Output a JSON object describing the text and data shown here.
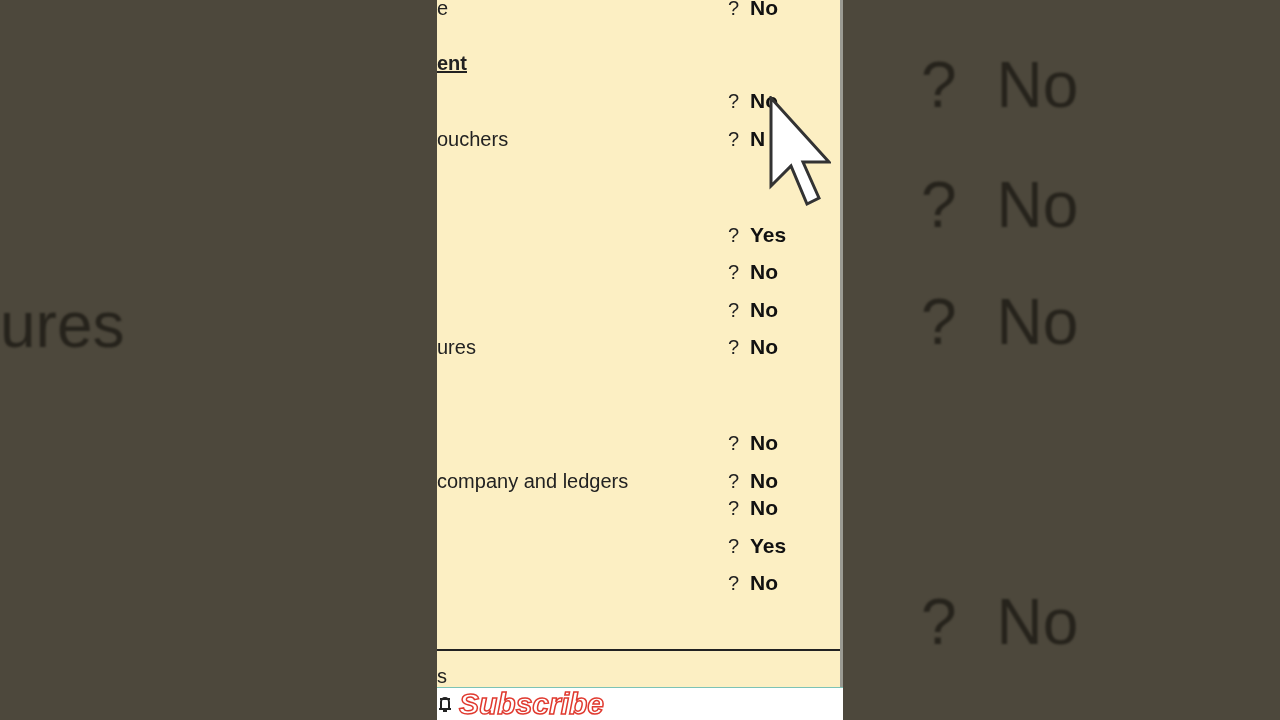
{
  "backdrop": {
    "left": [
      {
        "label": "ures"
      }
    ],
    "right": [
      {
        "mark": "?",
        "value": "No"
      },
      {
        "mark": "?",
        "value": "No"
      },
      {
        "mark": "?",
        "value": "No"
      },
      {
        "mark": "?",
        "value": "No"
      }
    ]
  },
  "panel": {
    "rows": [
      {
        "kind": "option",
        "label": "e",
        "mark": "?",
        "value": "No"
      },
      {
        "kind": "heading",
        "label": "ent"
      },
      {
        "kind": "option",
        "label": "",
        "mark": "?",
        "value": "No"
      },
      {
        "kind": "option",
        "label": "ouchers",
        "mark": "?",
        "value": "N"
      },
      {
        "kind": "option",
        "label": "",
        "mark": "?",
        "value": "Yes"
      },
      {
        "kind": "option",
        "label": "",
        "mark": "?",
        "value": "No"
      },
      {
        "kind": "option",
        "label": "",
        "mark": "?",
        "value": "No"
      },
      {
        "kind": "option",
        "label": "ures",
        "mark": "?",
        "value": "No"
      },
      {
        "kind": "option",
        "label": "",
        "mark": "?",
        "value": "No"
      },
      {
        "kind": "option",
        "label": "company and ledgers",
        "mark": "?",
        "value": "No"
      },
      {
        "kind": "option",
        "label": "",
        "mark": "?",
        "value": "No"
      },
      {
        "kind": "option",
        "label": "",
        "mark": "?",
        "value": "Yes"
      },
      {
        "kind": "option",
        "label": "",
        "mark": "?",
        "value": "No"
      }
    ],
    "footer": "s"
  },
  "subscribe": {
    "label": "Subscribe"
  }
}
